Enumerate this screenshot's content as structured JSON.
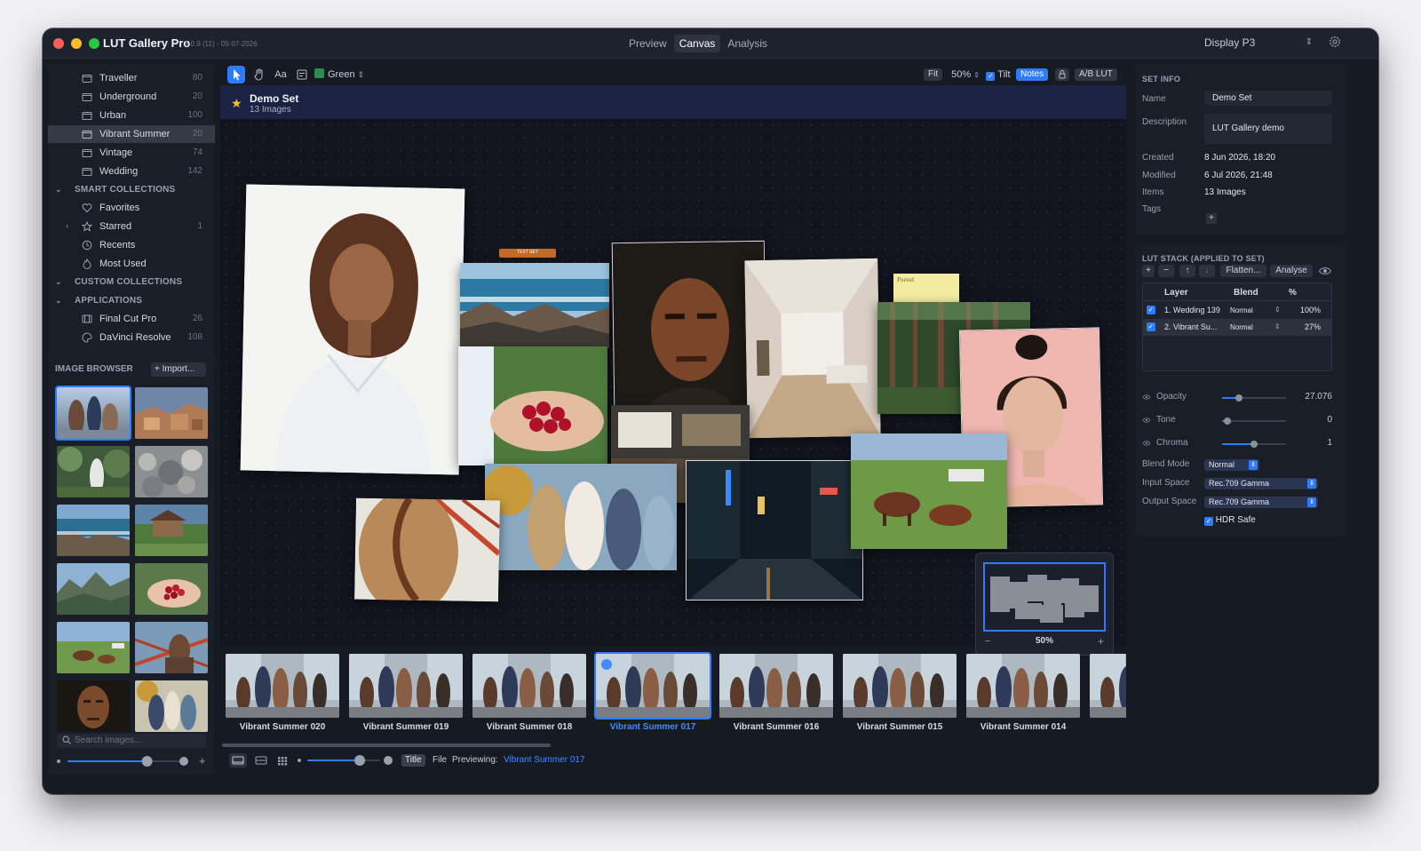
{
  "app": {
    "title": "LUT Gallery Pro",
    "version": "1.0.9 (11) · 05-07-2026"
  },
  "modes": [
    {
      "label": "Preview"
    },
    {
      "label": "Canvas"
    },
    {
      "label": "Analysis"
    }
  ],
  "display": {
    "value": "Display P3"
  },
  "sidebar": {
    "items": [
      {
        "label": "Traveller",
        "count": "80"
      },
      {
        "label": "Underground",
        "count": "20"
      },
      {
        "label": "Urban",
        "count": "100"
      },
      {
        "label": "Vibrant Summer",
        "count": "20"
      },
      {
        "label": "Vintage",
        "count": "74"
      },
      {
        "label": "Wedding",
        "count": "142"
      }
    ],
    "smart_title": "SMART COLLECTIONS",
    "smart": [
      {
        "label": "Favorites",
        "count": ""
      },
      {
        "label": "Starred",
        "count": "1"
      },
      {
        "label": "Recents",
        "count": ""
      },
      {
        "label": "Most Used",
        "count": ""
      }
    ],
    "custom_title": "CUSTOM COLLECTIONS",
    "apps_title": "APPLICATIONS",
    "apps": [
      {
        "label": "Final Cut Pro",
        "count": "26"
      },
      {
        "label": "DaVinci Resolve",
        "count": "108"
      }
    ]
  },
  "browser": {
    "title": "IMAGE BROWSER",
    "import_label": "Import...",
    "search_placeholder": "Search images...",
    "thumb_zoom": 0.7
  },
  "toolbar": {
    "text_tool": "Aa",
    "color_label": "Green",
    "fit_label": "Fit",
    "zoom_value": "50%",
    "tilt_label": "Tilt",
    "notes_label": "Notes",
    "ab_label": "A/B LUT"
  },
  "set": {
    "name": "Demo Set",
    "count": "13 Images"
  },
  "canvas": {
    "tag_label": "TEXT SET",
    "note_text": "Forest"
  },
  "minimap": {
    "zoom": "50%",
    "minus": "−",
    "plus": "+"
  },
  "filmstrip": {
    "items": [
      {
        "label": "Vibrant Summer 020"
      },
      {
        "label": "Vibrant Summer 019"
      },
      {
        "label": "Vibrant Summer 018"
      },
      {
        "label": "Vibrant Summer 017"
      },
      {
        "label": "Vibrant Summer 016"
      },
      {
        "label": "Vibrant Summer 015"
      },
      {
        "label": "Vibrant Summer 014"
      },
      {
        "label": "Vibrai"
      }
    ]
  },
  "bottom": {
    "title_label": "Title",
    "file_label": "File",
    "previewing_label": "Previewing:",
    "previewing_value": "Vibrant Summer 017",
    "strip_zoom": 0.72
  },
  "set_info": {
    "title": "SET INFO",
    "name_label": "Name",
    "name_value": "Demo Set",
    "desc_label": "Description",
    "desc_value": "LUT Gallery demo",
    "created_label": "Created",
    "created_value": "8 Jun 2026, 18:20",
    "modified_label": "Modified",
    "modified_value": "6 Jul 2026, 21:48",
    "items_label": "Items",
    "items_value": "13 Images",
    "tags_label": "Tags",
    "add_tag": "+"
  },
  "lut": {
    "title": "LUT STACK (APPLIED TO SET)",
    "add": "+",
    "remove": "−",
    "up": "↑",
    "down": "↓",
    "flatten_label": "Flatten...",
    "analyse_label": "Analyse",
    "col_layer": "Layer",
    "col_blend": "Blend",
    "col_pct": "%",
    "rows": [
      {
        "layer": "1. Wedding 139",
        "blend": "Normal",
        "pct": "100%"
      },
      {
        "layer": "2. Vibrant Su...",
        "blend": "Normal",
        "pct": "27%"
      }
    ],
    "sliders": [
      {
        "label": "Opacity",
        "value": "27.076",
        "level": 0.27
      },
      {
        "label": "Tone",
        "value": "0",
        "level": 0.08
      },
      {
        "label": "Chroma",
        "value": "1",
        "level": 0.5
      }
    ],
    "blend_mode_label": "Blend Mode",
    "blend_mode_value": "Normal",
    "input_space_label": "Input Space",
    "input_space_value": "Rec.709 Gamma",
    "output_space_label": "Output Space",
    "output_space_value": "Rec.709 Gamma",
    "hdr_label": "HDR Safe"
  },
  "colors": {
    "accent": "#2f7bff",
    "banner": "#1b2344",
    "window_bg": "#161a23"
  }
}
